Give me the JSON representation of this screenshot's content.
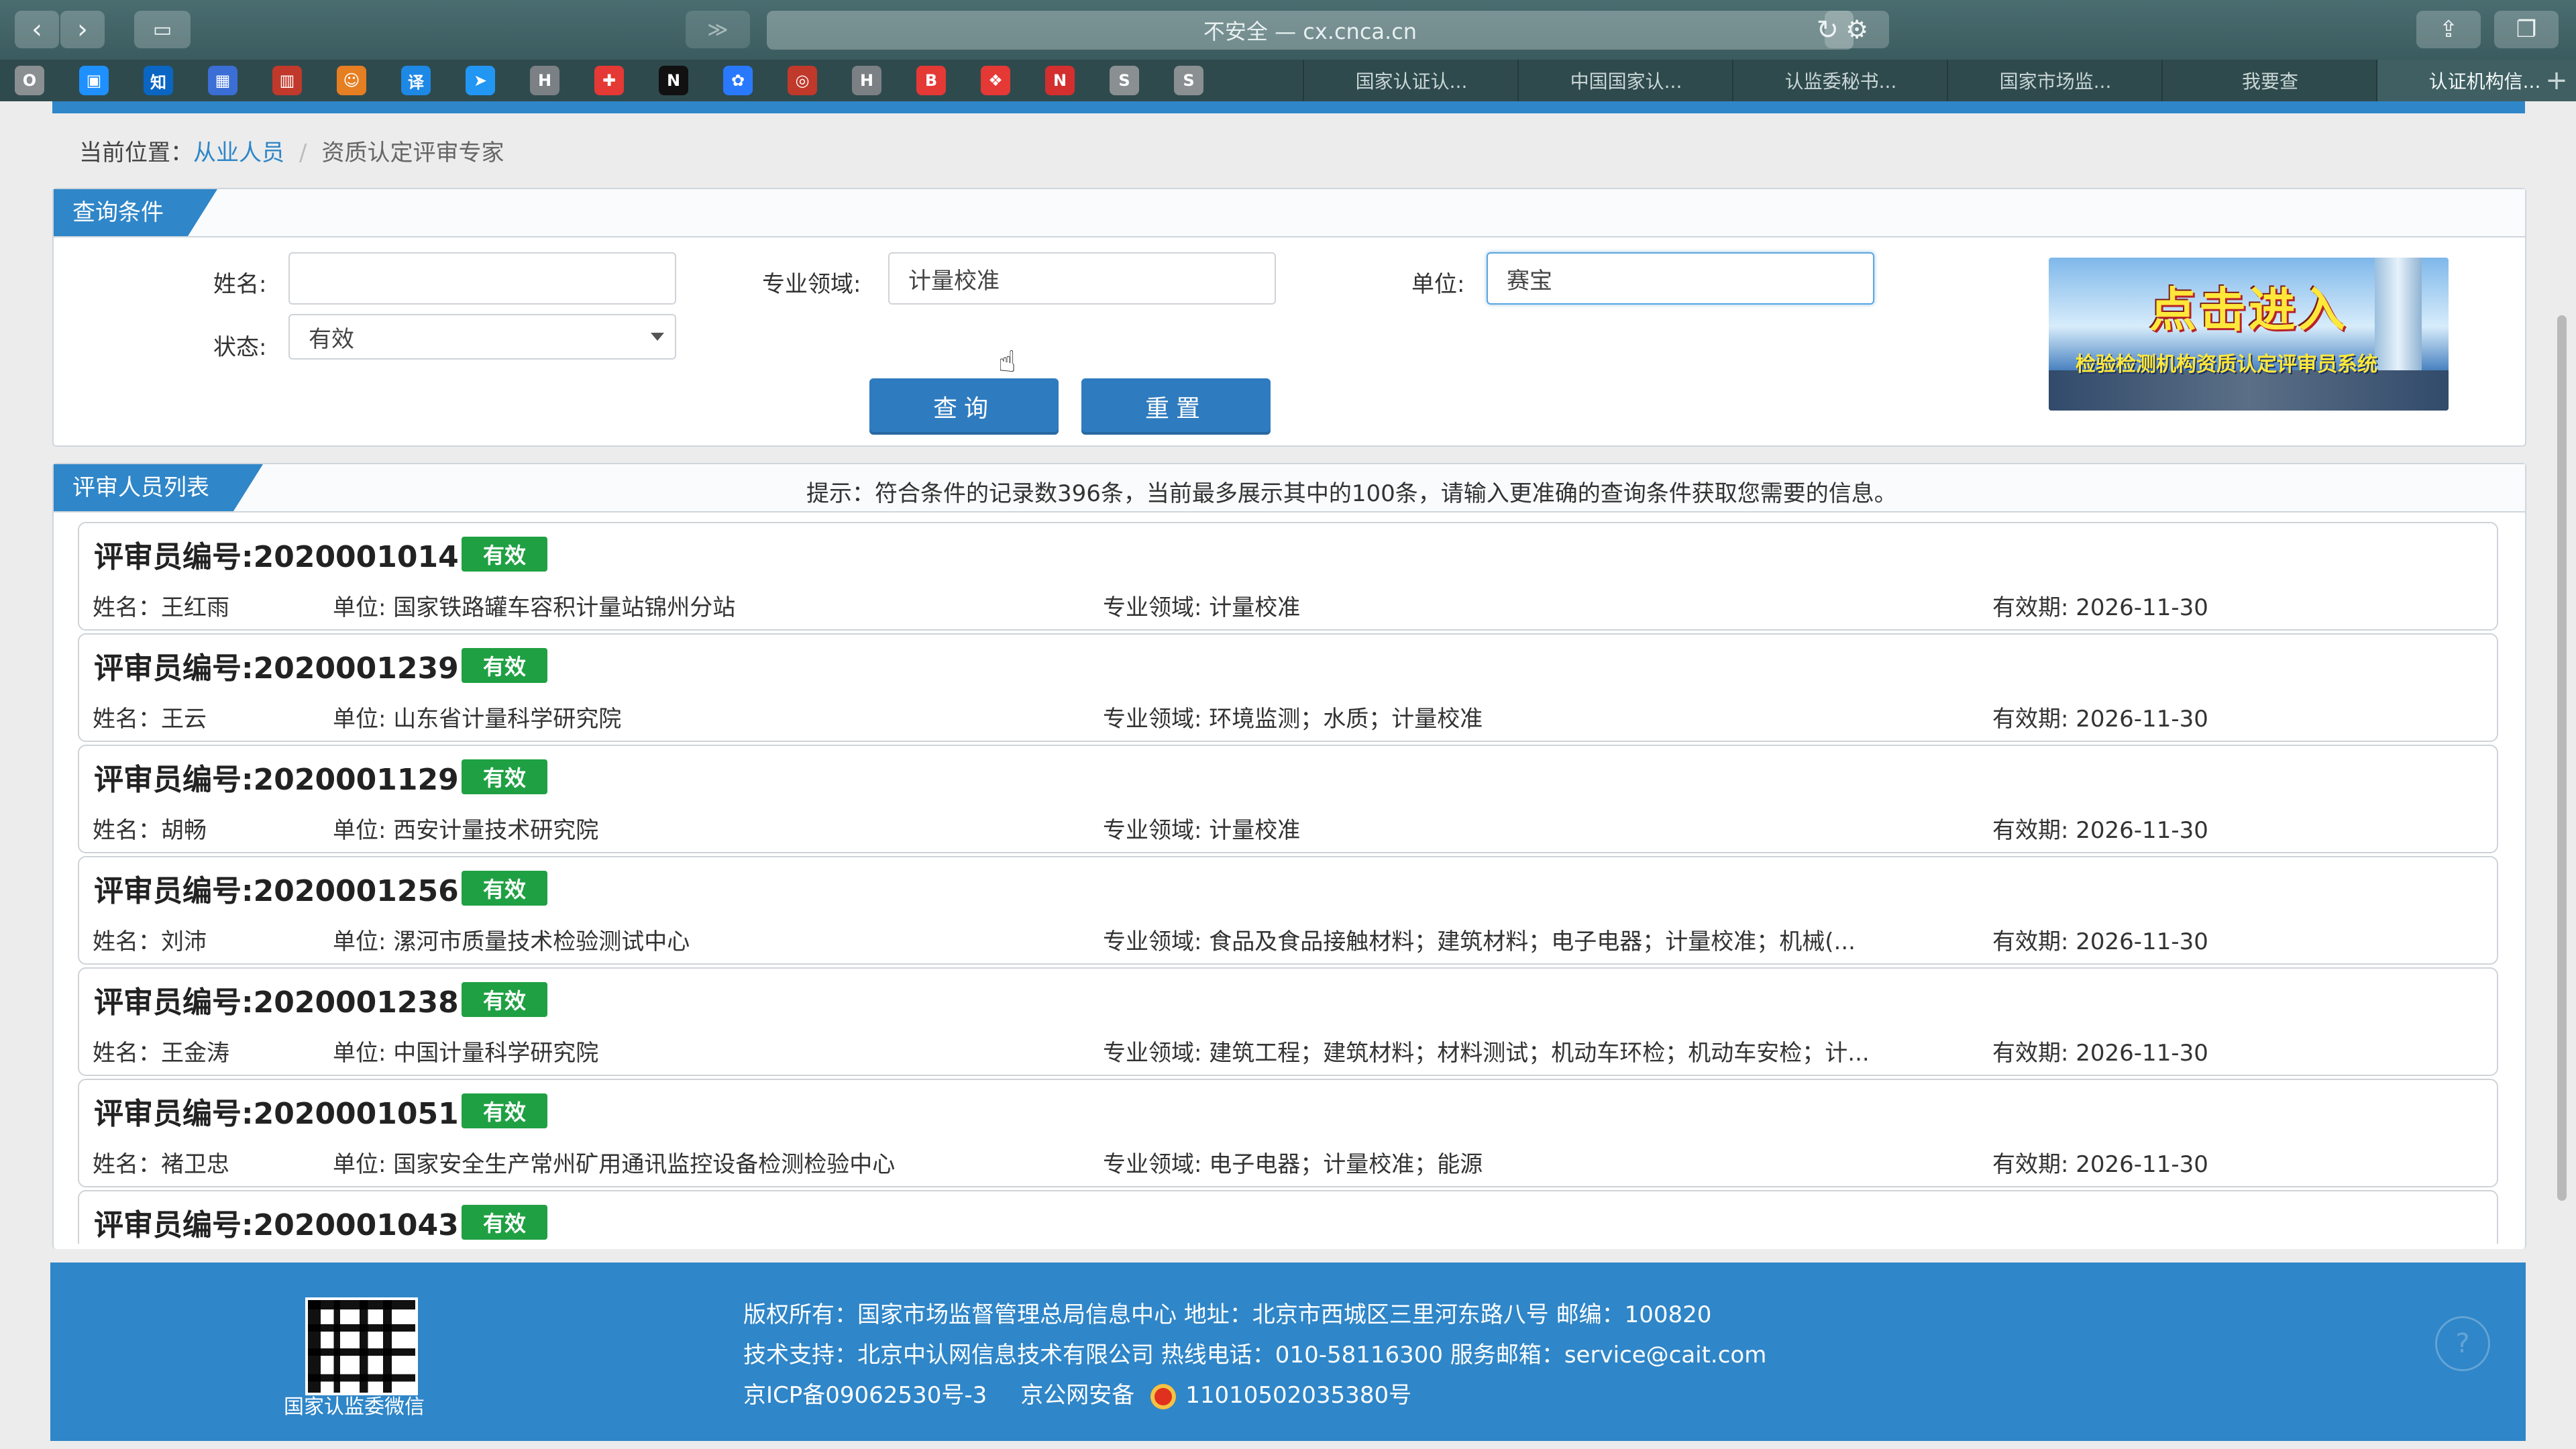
{
  "browser": {
    "url": "不安全 — cx.cnca.cn",
    "tabs": [
      {
        "label": "国家认证认..."
      },
      {
        "label": "中国国家认..."
      },
      {
        "label": "认监委秘书..."
      },
      {
        "label": "国家市场监..."
      },
      {
        "label": "我要查"
      },
      {
        "label": "认证机构信..."
      }
    ],
    "bookmarks": [
      {
        "glyph": "O",
        "color": "#8a8f92"
      },
      {
        "glyph": "▣",
        "color": "#1e90ff"
      },
      {
        "glyph": "知",
        "color": "#0a66c2"
      },
      {
        "glyph": "▦",
        "color": "#3b6fd6"
      },
      {
        "glyph": "▥",
        "color": "#c0392b"
      },
      {
        "glyph": "☺",
        "color": "#e67e22"
      },
      {
        "glyph": "译",
        "color": "#1e88e5"
      },
      {
        "glyph": "➤",
        "color": "#2196f3"
      },
      {
        "glyph": "H",
        "color": "#7b8085"
      },
      {
        "glyph": "✚",
        "color": "#e53935"
      },
      {
        "glyph": "N",
        "color": "#111111"
      },
      {
        "glyph": "✿",
        "color": "#2979ff"
      },
      {
        "glyph": "◎",
        "color": "#c0392b"
      },
      {
        "glyph": "H",
        "color": "#7b8085"
      },
      {
        "glyph": "B",
        "color": "#e53935"
      },
      {
        "glyph": "❖",
        "color": "#e53935"
      },
      {
        "glyph": "N",
        "color": "#d32f2f"
      },
      {
        "glyph": "S",
        "color": "#8a8f92"
      },
      {
        "glyph": "S",
        "color": "#8a8f92"
      }
    ]
  },
  "breadcrumb": {
    "prefix": "当前位置：",
    "link": "从业人员",
    "separator": "/",
    "current": "资质认定评审专家"
  },
  "query": {
    "title": "查询条件",
    "name_label": "姓名:",
    "name_value": "",
    "field_label": "专业领域:",
    "field_value": "计量校准",
    "unit_label": "单位:",
    "unit_value": "赛宝",
    "status_label": "状态:",
    "status_value": "有效",
    "search_button": "查询",
    "reset_button": "重置",
    "banner_big": "点击进入",
    "banner_small": "检验检测机构资质认定评审员系统"
  },
  "list": {
    "title": "评审人员列表",
    "hint": "提示：符合条件的记录数396条，当前最多展示其中的100条，请输入更准确的查询条件获取您需要的信息。",
    "records": [
      {
        "id": "评审员编号:2020001014",
        "status": "有效",
        "name": "姓名：王红雨",
        "unit": "单位: 国家铁路罐车容积计量站锦州分站",
        "field": "专业领域: 计量校准",
        "expiry": "有效期: 2026-11-30"
      },
      {
        "id": "评审员编号:2020001239",
        "status": "有效",
        "name": "姓名：王云",
        "unit": "单位: 山东省计量科学研究院",
        "field": "专业领域: 环境监测；水质；计量校准",
        "expiry": "有效期: 2026-11-30"
      },
      {
        "id": "评审员编号:2020001129",
        "status": "有效",
        "name": "姓名：胡畅",
        "unit": "单位: 西安计量技术研究院",
        "field": "专业领域: 计量校准",
        "expiry": "有效期: 2026-11-30"
      },
      {
        "id": "评审员编号:2020001256",
        "status": "有效",
        "name": "姓名：刘沛",
        "unit": "单位: 漯河市质量技术检验测试中心",
        "field": "专业领域: 食品及食品接触材料；建筑材料；电子电器；计量校准；机械(...",
        "expiry": "有效期: 2026-11-30"
      },
      {
        "id": "评审员编号:2020001238",
        "status": "有效",
        "name": "姓名：王金涛",
        "unit": "单位: 中国计量科学研究院",
        "field": "专业领域: 建筑工程；建筑材料；材料测试；机动车环检；机动车安检；计...",
        "expiry": "有效期: 2026-11-30"
      },
      {
        "id": "评审员编号:2020001051",
        "status": "有效",
        "name": "姓名：褚卫忠",
        "unit": "单位: 国家安全生产常州矿用通讯监控设备检测检验中心",
        "field": "专业领域: 电子电器；计量校准；能源",
        "expiry": "有效期: 2026-11-30"
      },
      {
        "id": "评审员编号:2020001043",
        "status": "有效",
        "name": "",
        "unit": "",
        "field": "",
        "expiry": ""
      }
    ]
  },
  "footer": {
    "qr_caption": "国家认监委微信",
    "copyright": "版权所有：国家市场监督管理总局信息中心    地址：北京市西城区三里河东路八号    邮编：100820",
    "support": "技术支持：北京中认网信息技术有限公司    热线电话：010-58116300    服务邮箱：service@cait.com",
    "icp": "京ICP备09062530号-3",
    "police": "京公网安备",
    "police_no": "11010502035380号"
  },
  "colors": {
    "primary": "#2f86c8",
    "badge": "#1fa043"
  }
}
